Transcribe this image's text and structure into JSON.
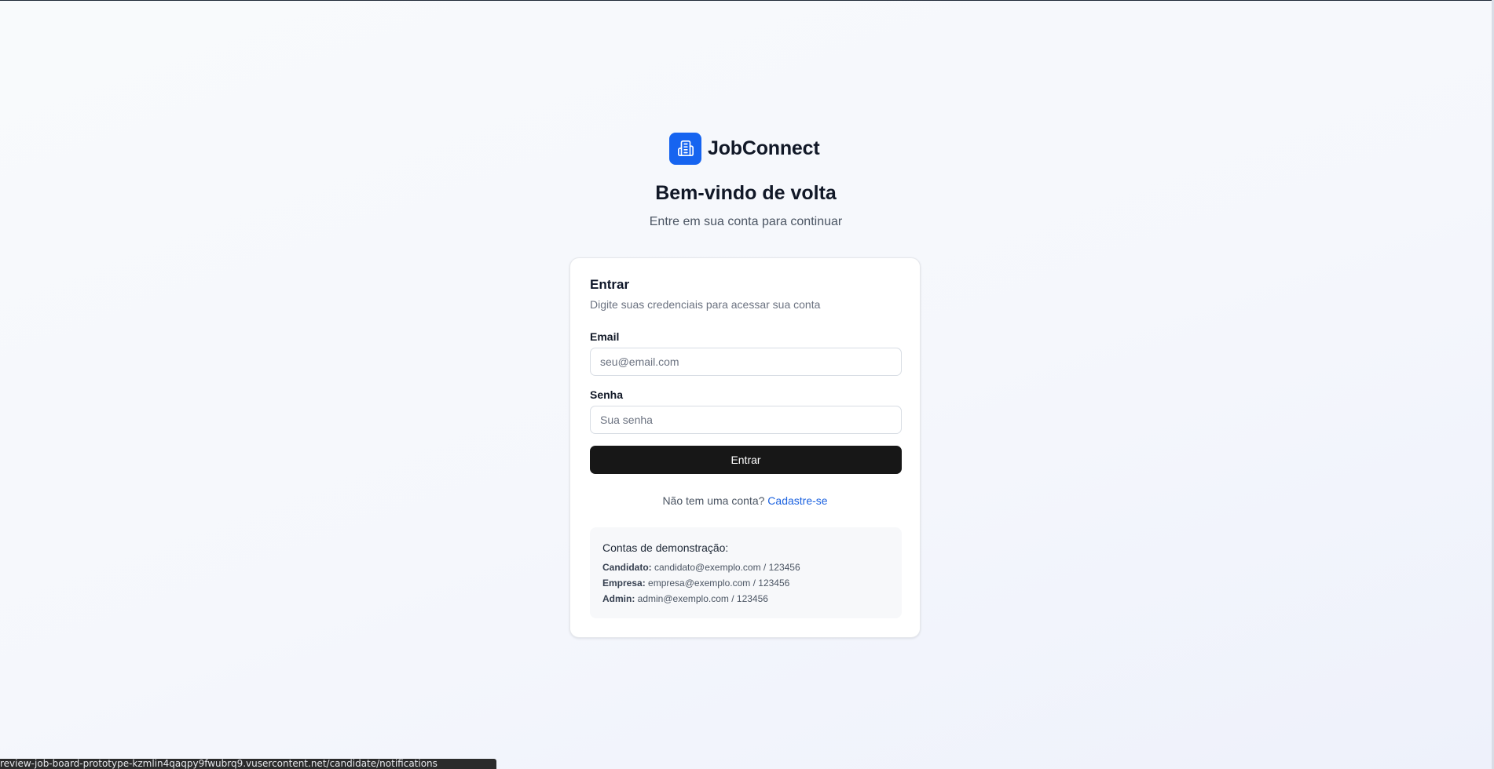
{
  "brand": {
    "name": "JobConnect",
    "logo_icon": "building-icon",
    "logo_color": "#1664f0"
  },
  "header": {
    "title": "Bem-vindo de volta",
    "subtitle": "Entre em sua conta para continuar"
  },
  "login_card": {
    "title": "Entrar",
    "description": "Digite suas credenciais para acessar sua conta",
    "email": {
      "label": "Email",
      "placeholder": "seu@email.com",
      "value": ""
    },
    "password": {
      "label": "Senha",
      "placeholder": "Sua senha",
      "value": ""
    },
    "submit_label": "Entrar",
    "signup_prompt": "Não tem uma conta?",
    "signup_link": "Cadastre-se",
    "demo": {
      "title": "Contas de demonstração:",
      "accounts": [
        {
          "role": "Candidato:",
          "credentials": "candidato@exemplo.com / 123456"
        },
        {
          "role": "Empresa:",
          "credentials": "empresa@exemplo.com / 123456"
        },
        {
          "role": "Admin:",
          "credentials": "admin@exemplo.com / 123456"
        }
      ]
    }
  },
  "status_bar": {
    "url": "review-job-board-prototype-kzmlin4qaqpy9fwubrq9.vusercontent.net/candidate/notifications"
  },
  "colors": {
    "primary": "#1664f0",
    "button": "#171717",
    "link": "#1d63e0"
  }
}
